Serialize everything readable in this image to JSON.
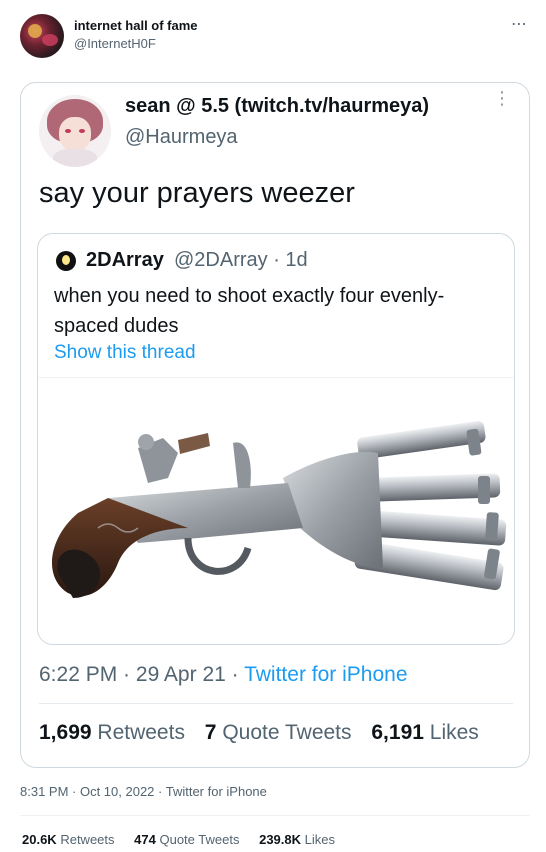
{
  "outer": {
    "display_name": "internet hall of fame",
    "handle": "@InternetH0F",
    "more_icon": "⋯",
    "timestamp": "8:31 PM · Oct 10, 2022 · Twitter for iPhone",
    "stats": [
      {
        "value": "20.6K",
        "label": "Retweets"
      },
      {
        "value": "474",
        "label": "Quote Tweets"
      },
      {
        "value": "239.8K",
        "label": "Likes"
      }
    ]
  },
  "inner": {
    "display_name": "sean @ 5.5 (twitch.tv/haurmeya)",
    "handle": "@Haurmeya",
    "more_icon": "⋮",
    "text": "say your prayers weezer",
    "time": "6:22 PM",
    "sep": " · ",
    "date": "29 Apr 21",
    "source": "Twitter for iPhone",
    "stats": [
      {
        "value": "1,699",
        "label": "Retweets"
      },
      {
        "value": "7",
        "label": "Quote Tweets"
      },
      {
        "value": "6,191",
        "label": "Likes"
      }
    ]
  },
  "quote": {
    "display_name": "2DArray",
    "meta": "@2DArray · 1d",
    "text": "when you need to shoot exactly four evenly-spaced dudes",
    "link": "Show this thread",
    "image_icon": "flintlock-duck-foot-pistol-image"
  }
}
